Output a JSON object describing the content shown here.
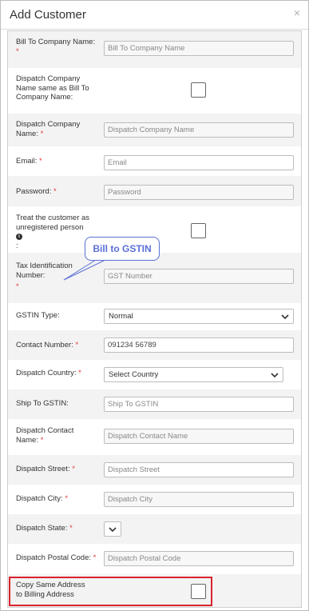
{
  "modal": {
    "title": "Add Customer",
    "close_glyph": "×"
  },
  "fields": {
    "bill_to_company": {
      "label": "Bill To Company Name:",
      "required_mark": "*",
      "placeholder": "Bill To Company Name"
    },
    "dispatch_same": {
      "label": "Dispatch Company Name same as Bill To Company Name:"
    },
    "dispatch_company": {
      "label": "Dispatch Company Name:",
      "required_mark": "*",
      "placeholder": "Dispatch Company Name"
    },
    "email": {
      "label": "Email:",
      "required_mark": "*",
      "placeholder": "Email"
    },
    "password": {
      "label": "Password:",
      "required_mark": "*",
      "placeholder": "Password"
    },
    "unregistered": {
      "label": "Treat the customer as unregistered person",
      "suffix": ":",
      "info_glyph": "i"
    },
    "tax_id": {
      "label": "Tax Identification Number:",
      "required_mark": "*",
      "placeholder": "GST Number"
    },
    "gstin_type": {
      "label": "GSTIN Type:",
      "value": "Normal"
    },
    "contact_number": {
      "label": "Contact Number:",
      "required_mark": "*",
      "placeholder": "091234 56789"
    },
    "dispatch_country": {
      "label": "Dispatch Country:",
      "required_mark": "*",
      "value": "Select Country"
    },
    "ship_to_gstin": {
      "label": "Ship To GSTIN:",
      "placeholder": "Ship To GSTIN"
    },
    "dispatch_contact": {
      "label": "Dispatch Contact Name:",
      "required_mark": "*",
      "placeholder": "Dispatch Contact Name"
    },
    "dispatch_street": {
      "label": "Dispatch Street:",
      "required_mark": "*",
      "placeholder": "Dispatch Street"
    },
    "dispatch_city": {
      "label": "Dispatch City:",
      "required_mark": "*",
      "placeholder": "Dispatch City"
    },
    "dispatch_state": {
      "label": "Dispatch State:",
      "required_mark": "*"
    },
    "dispatch_postal": {
      "label": "Dispatch Postal Code:",
      "required_mark": "*",
      "placeholder": "Dispatch Postal Code"
    },
    "copy_address": {
      "label": "Copy Same Address to Billing Address"
    }
  },
  "annotation": {
    "callout_text": "Bill to GSTIN",
    "highlight_color": "#d9232d",
    "callout_color": "#5a6fd6"
  },
  "colors": {
    "required": "#e53935",
    "row_alt": "#f3f3f3"
  }
}
